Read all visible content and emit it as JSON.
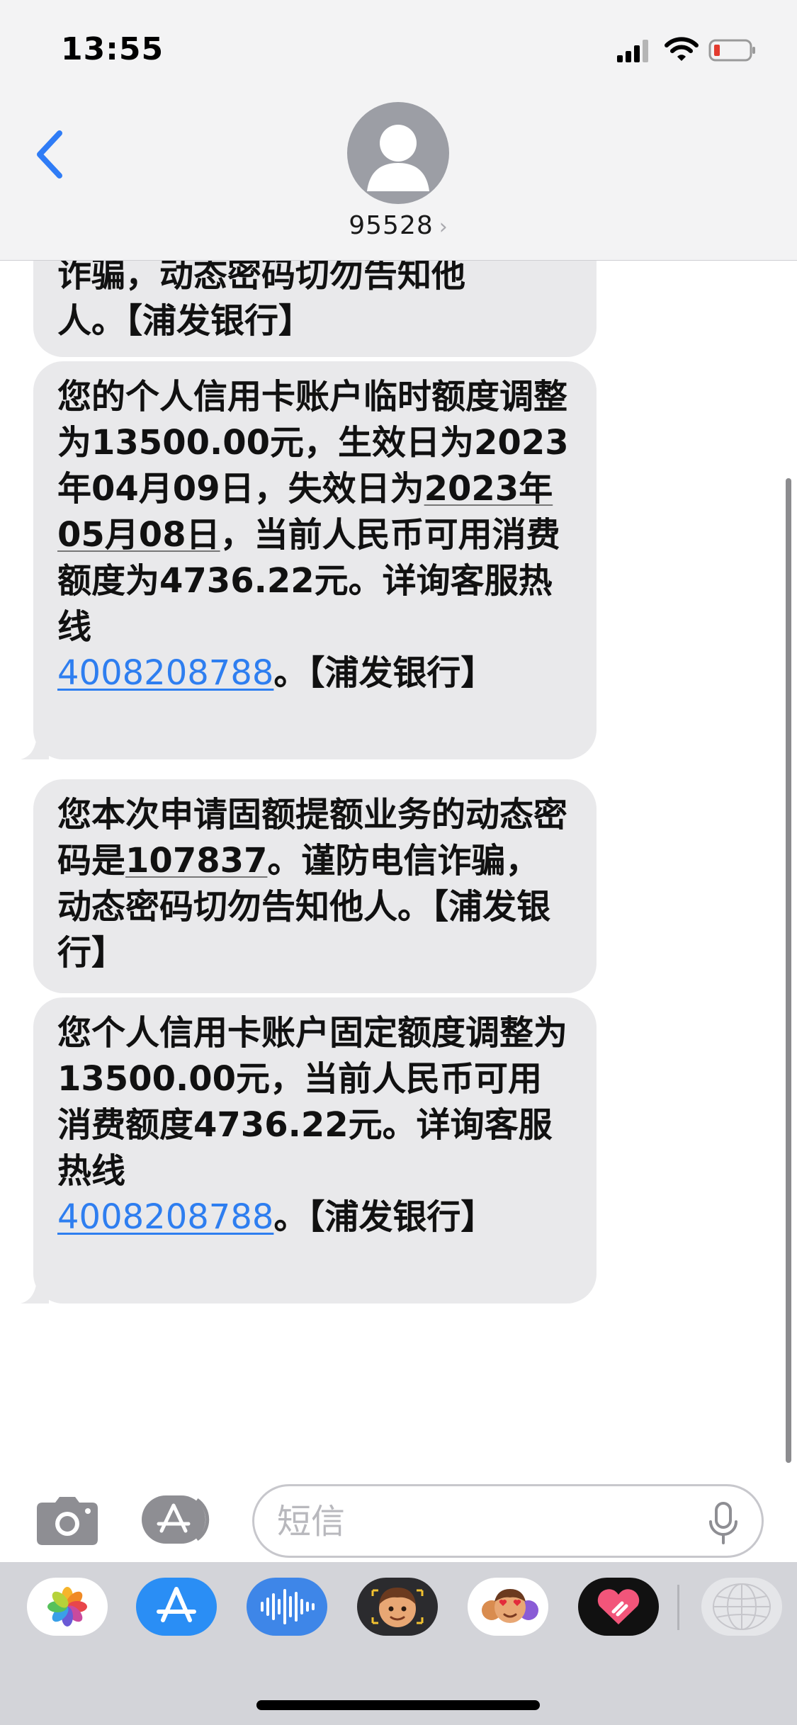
{
  "status_bar": {
    "time": "13:55"
  },
  "header": {
    "contact_name": "95528",
    "back_label": "back"
  },
  "messages": [
    {
      "segments": [
        "诈骗，动态密码切勿告知他",
        "人。【浦发银行】"
      ]
    },
    {
      "parts": {
        "p1": "您的个人信用卡账户临时额度调整为13500.00元，生效日为2023年04月09日，失效日为",
        "date": "2023年05月08日",
        "p2": "，当前人民币可用消费额度为4736.22元。详询客服热线",
        "phone": "4008208788",
        "p3": "。【浦发银行】"
      }
    },
    {
      "parts": {
        "p1": "您本次申请固额提额业务的动态密码是",
        "code": "107837",
        "p2": "。谨防电信诈骗，动态密码切勿告知他人。【浦发银行】"
      }
    },
    {
      "parts": {
        "p1": "您个人信用卡账户固定额度调整为13500.00元，当前人民币可用消费额度4736.22元。详询客服热线",
        "phone": "4008208788",
        "p2": "。【浦发银行】"
      }
    }
  ],
  "input": {
    "placeholder": "短信",
    "value": ""
  },
  "app_drawer": {
    "apps": [
      "photos-icon",
      "app-store-icon",
      "audio-message-icon",
      "memoji-icon",
      "memoji-stickers-icon",
      "digital-touch-icon",
      "globe-search-icon"
    ]
  },
  "colors": {
    "bubble_gray": "#e9e9eb",
    "link_blue": "#2e7ef0",
    "ios_blue": "#2f7cf6",
    "header_bg": "#f3f3f4"
  }
}
